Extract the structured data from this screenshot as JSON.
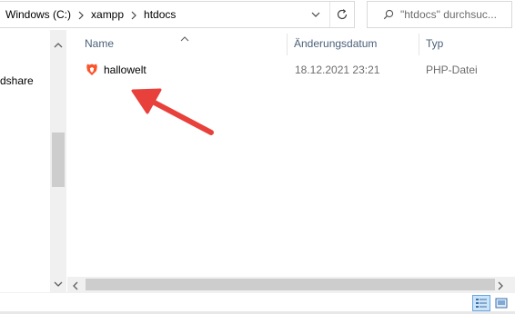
{
  "address": {
    "crumbs": [
      "Windows (C:)",
      "xampp",
      "htdocs"
    ]
  },
  "search": {
    "placeholder": "\"htdocs\" durchsuc..."
  },
  "nav": {
    "items": [
      {
        "label": "dshare"
      }
    ]
  },
  "columns": {
    "name": "Name",
    "date": "Änderungsdatum",
    "type": "Typ"
  },
  "files": [
    {
      "name": "hallowelt",
      "date": "18.12.2021 23:21",
      "type": "PHP-Datei",
      "icon": "brave-lion-icon"
    }
  ],
  "annotation": {
    "color": "#e8413c",
    "icon": "red-arrow-icon"
  },
  "status": {
    "views": [
      "details-view-icon",
      "large-icons-view-icon"
    ]
  },
  "colors": {
    "header_text": "#4c607a",
    "secondary_text": "#6d6d6d",
    "brave_orange": "#fb542b",
    "selection": "#cce4f7"
  }
}
